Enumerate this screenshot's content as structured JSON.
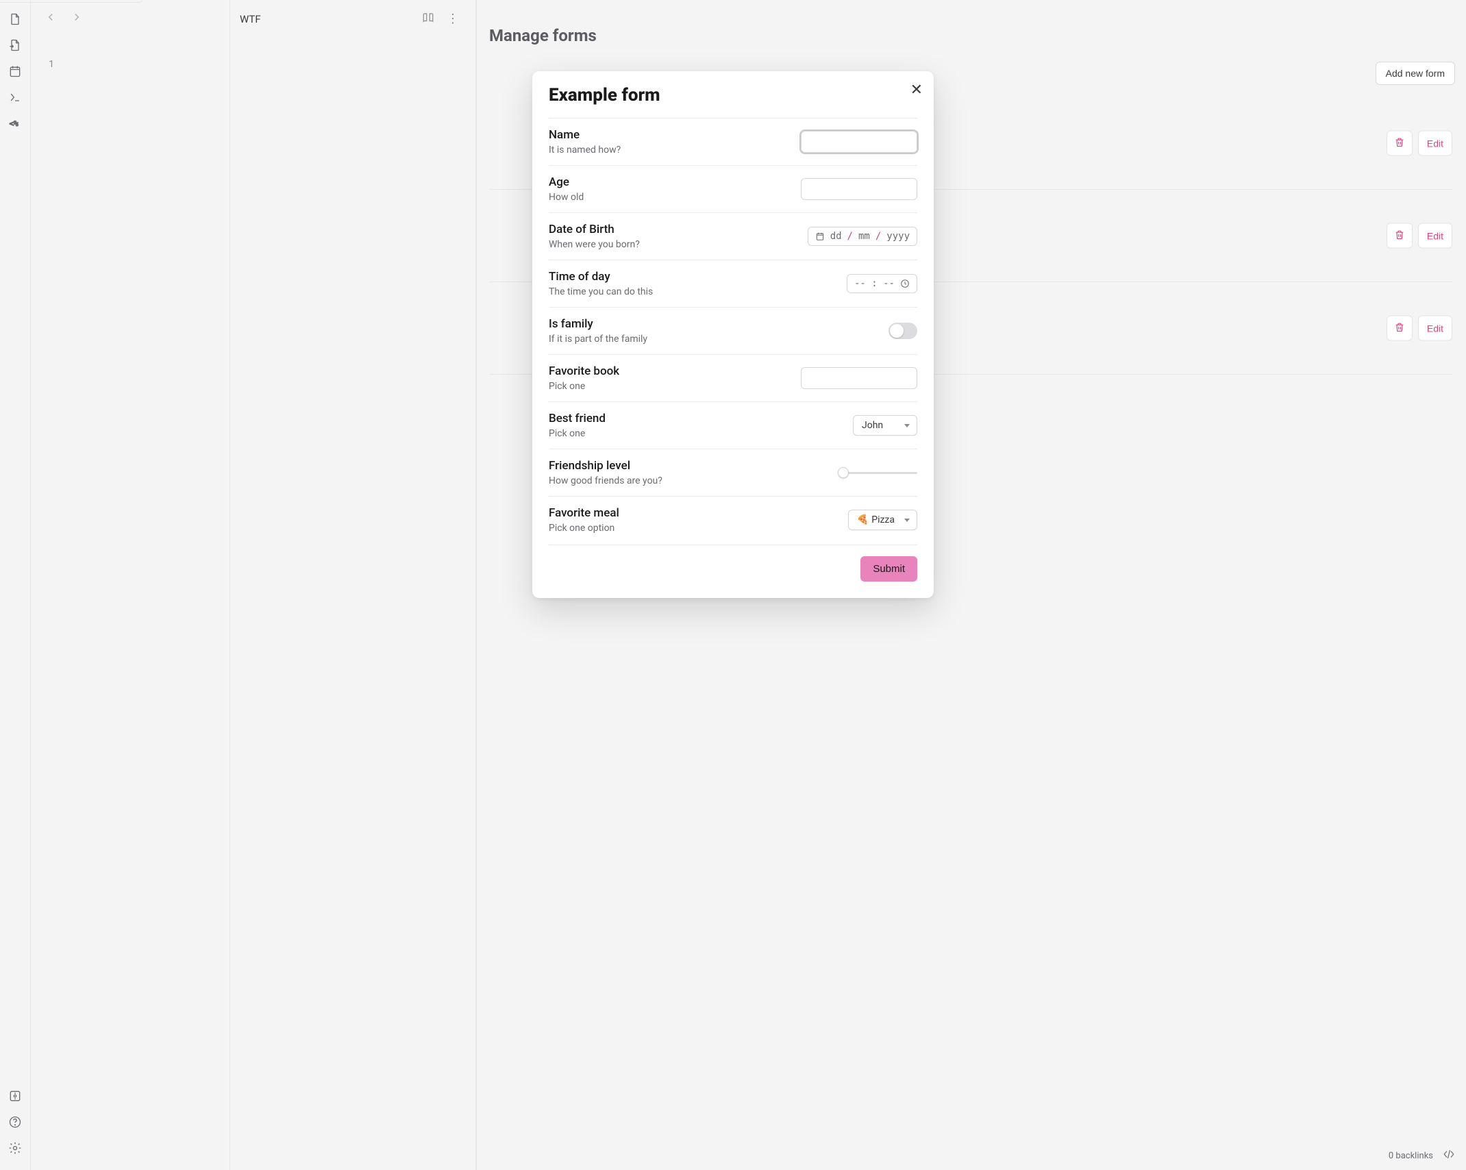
{
  "rail": {
    "icons": [
      "file-icon",
      "file-import-icon",
      "calendar-icon",
      "terminal-icon",
      "template-icon"
    ],
    "bottom_icons": [
      "vault-icon",
      "help-icon",
      "settings-icon"
    ]
  },
  "gutter": {
    "line_number": "1"
  },
  "note": {
    "title": "WTF"
  },
  "right_pane": {
    "heading": "Manage forms",
    "add_button": "Add new form",
    "rows": [
      {
        "edit": "Edit"
      },
      {
        "edit": "Edit"
      },
      {
        "edit": "Edit"
      }
    ]
  },
  "footer": {
    "backlinks": "0 backlinks"
  },
  "modal": {
    "title": "Example form",
    "submit": "Submit",
    "fields": {
      "name": {
        "label": "Name",
        "desc": "It is named how?",
        "value": ""
      },
      "age": {
        "label": "Age",
        "desc": "How old",
        "value": ""
      },
      "dob": {
        "label": "Date of Birth",
        "desc": "When were you born?",
        "placeholder_dd": "dd",
        "placeholder_mm": "mm",
        "placeholder_yyyy": "yyyy"
      },
      "time": {
        "label": "Time of day",
        "desc": "The time you can do this",
        "placeholder": "-- : --"
      },
      "family": {
        "label": "Is family",
        "desc": "If it is part of the family",
        "value": false
      },
      "book": {
        "label": "Favorite book",
        "desc": "Pick one",
        "value": ""
      },
      "friend": {
        "label": "Best friend",
        "desc": "Pick one",
        "selected": "John"
      },
      "level": {
        "label": "Friendship level",
        "desc": "How good friends are you?",
        "value": 0
      },
      "meal": {
        "label": "Favorite meal",
        "desc": "Pick one option",
        "selected": "Pizza",
        "emoji": "🍕"
      }
    }
  }
}
